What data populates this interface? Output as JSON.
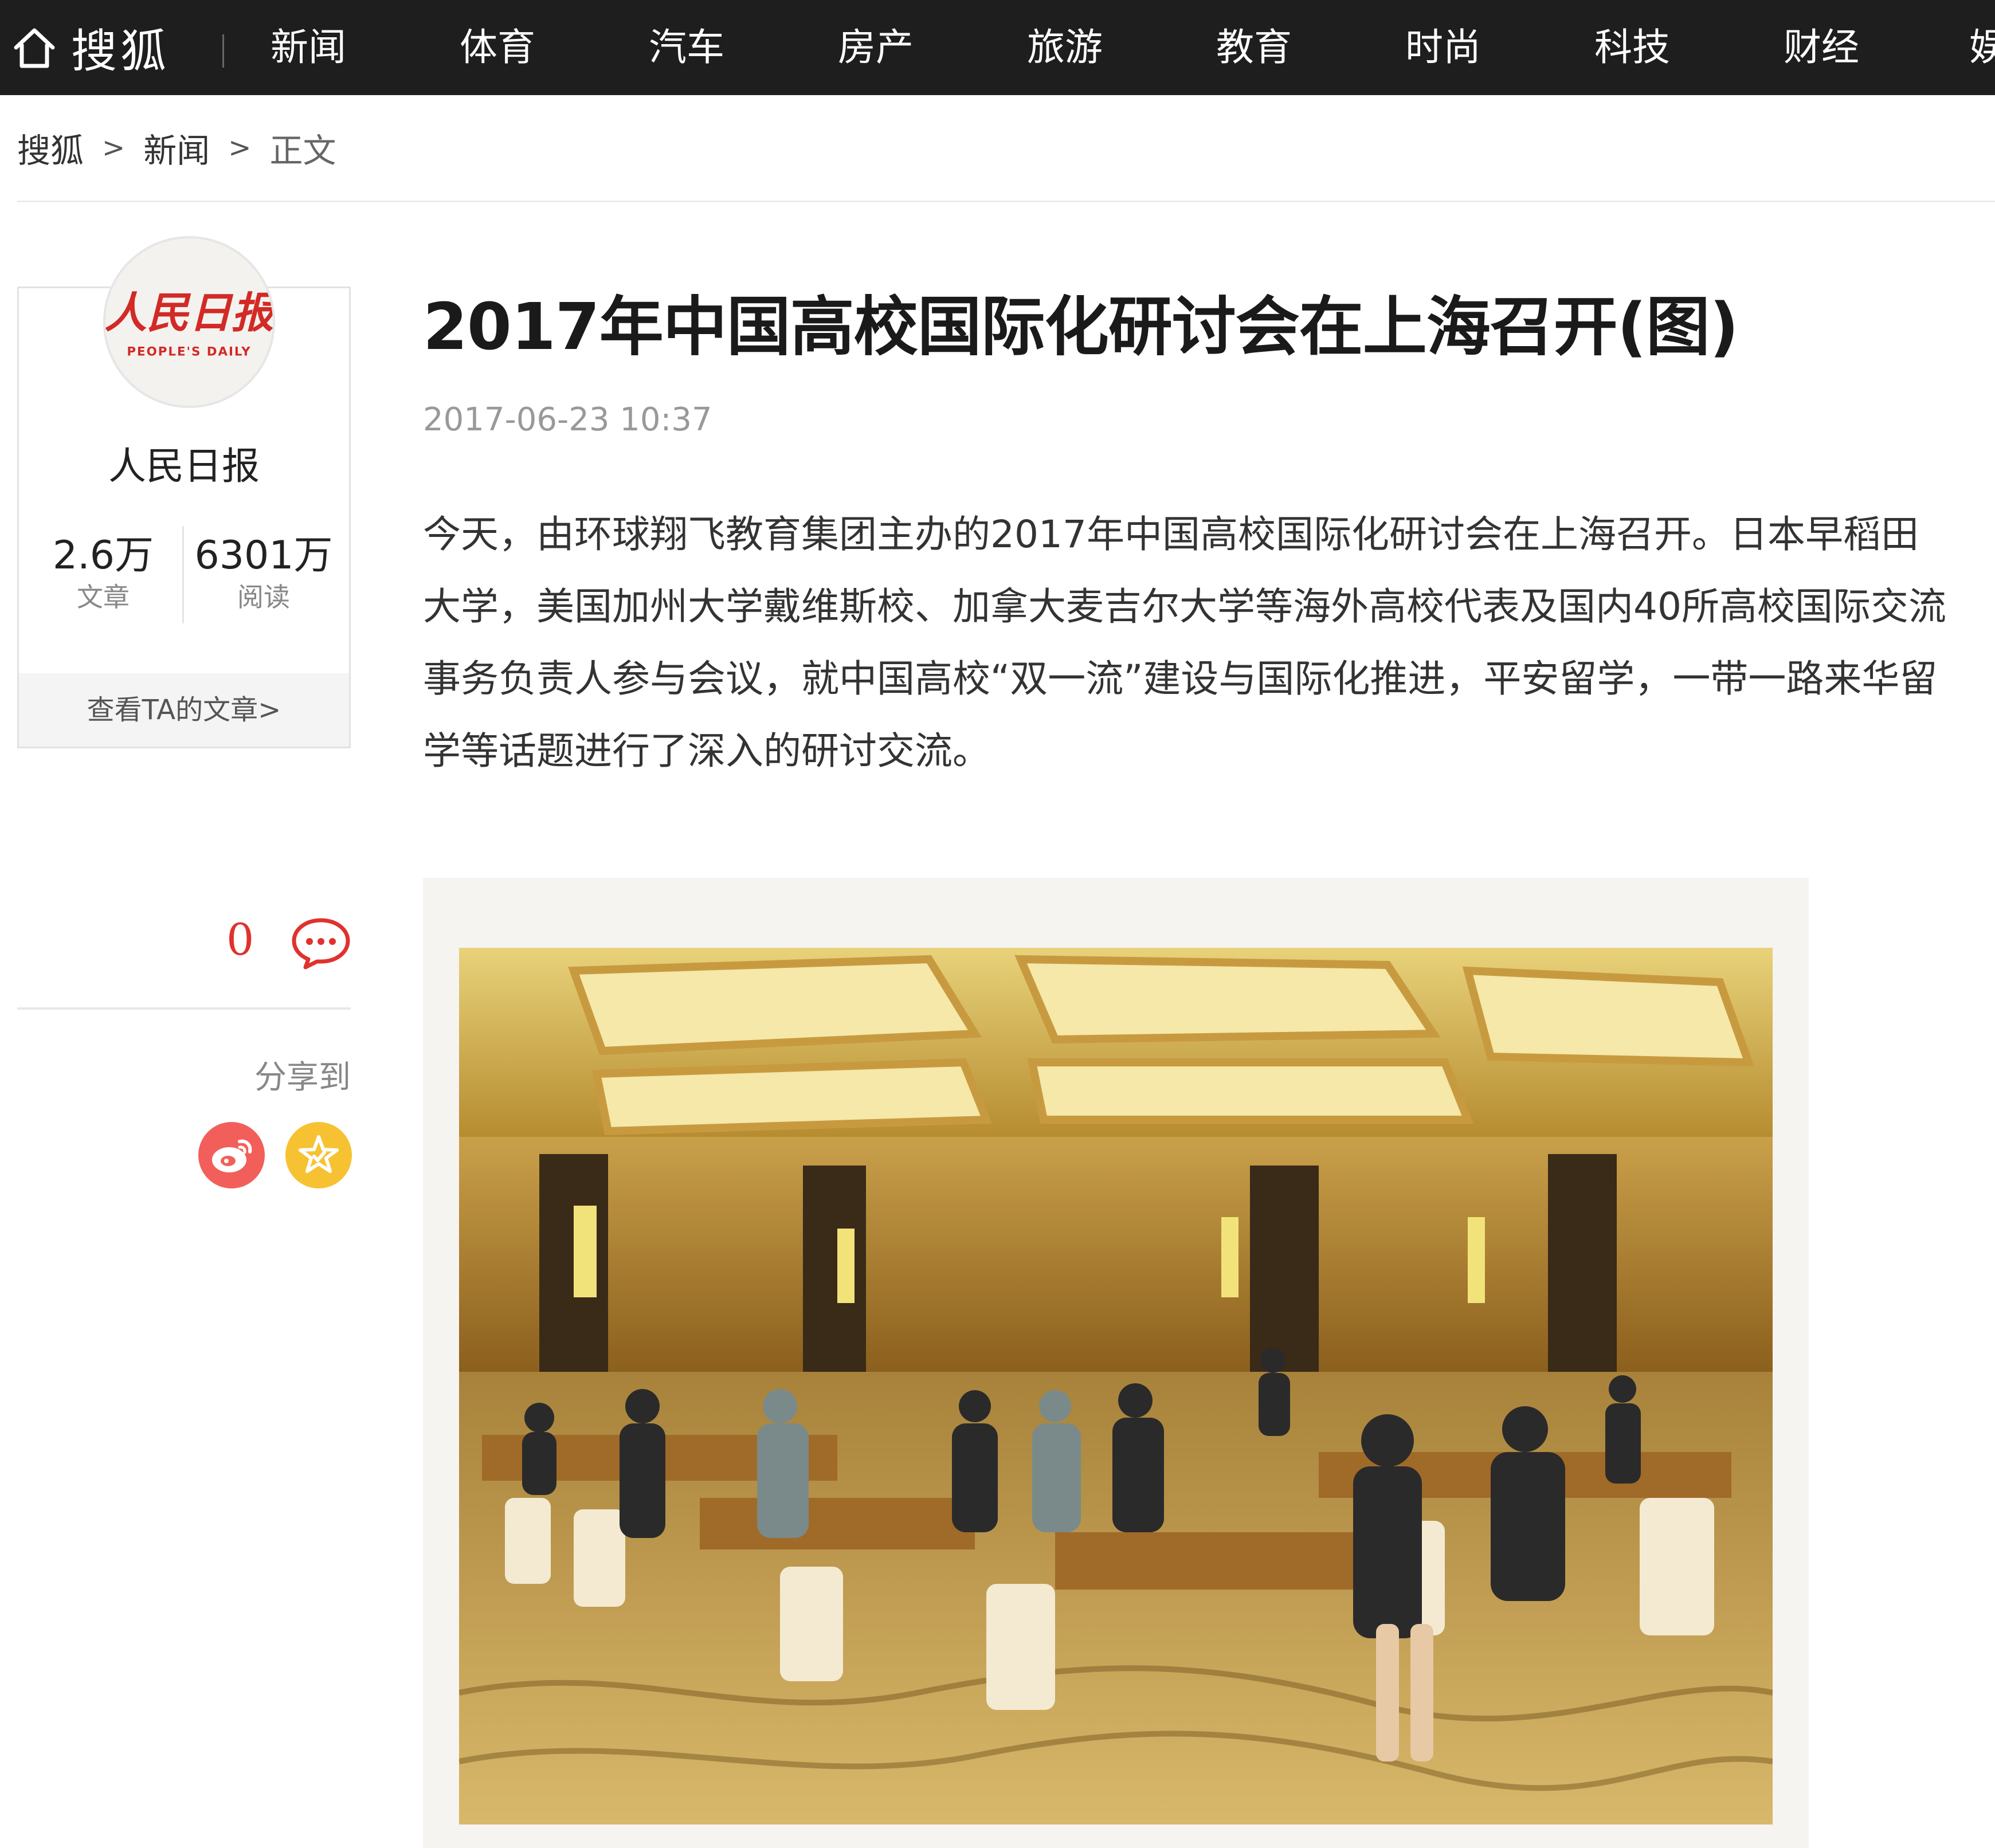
{
  "site": {
    "brand": "搜狐"
  },
  "nav": {
    "items": [
      "新闻",
      "体育",
      "汽车",
      "房产",
      "旅游",
      "教育",
      "时尚",
      "科技",
      "财经",
      "娱"
    ]
  },
  "breadcrumb": {
    "items": [
      "搜狐",
      "新闻",
      "正文"
    ],
    "separator": ">"
  },
  "author": {
    "logo_text": "人民日报",
    "logo_subtext": "PEOPLE'S DAILY",
    "name": "人民日报",
    "stats": [
      {
        "value": "2.6万",
        "label": "文章"
      },
      {
        "value": "6301万",
        "label": "阅读"
      }
    ],
    "view_articles_label": "查看TA的文章>"
  },
  "tools": {
    "comment_count": "0",
    "share_label": "分享到",
    "share_targets": [
      "weibo-icon",
      "favorite-star-icon"
    ]
  },
  "article": {
    "title": "2017年中国高校国际化研讨会在上海召开(图)",
    "time": "2017-06-23 10:37",
    "body": "今天，由环球翔飞教育集团主办的2017年中国高校国际化研讨会在上海召开。日本早稻田大学，美国加州大学戴维斯校、加拿大麦吉尔大学等海外高校代表及国内40所高校国际交流事务负责人参与会议，就中国高校“双一流”建设与国际化推进，平安留学，一带一路来华留学等话题进行了深入的研讨交流。"
  },
  "colors": {
    "nav_bg": "#1e1e1e",
    "accent_red": "#e0322d",
    "weibo": "#f25f5a",
    "favorite": "#f7c232"
  }
}
